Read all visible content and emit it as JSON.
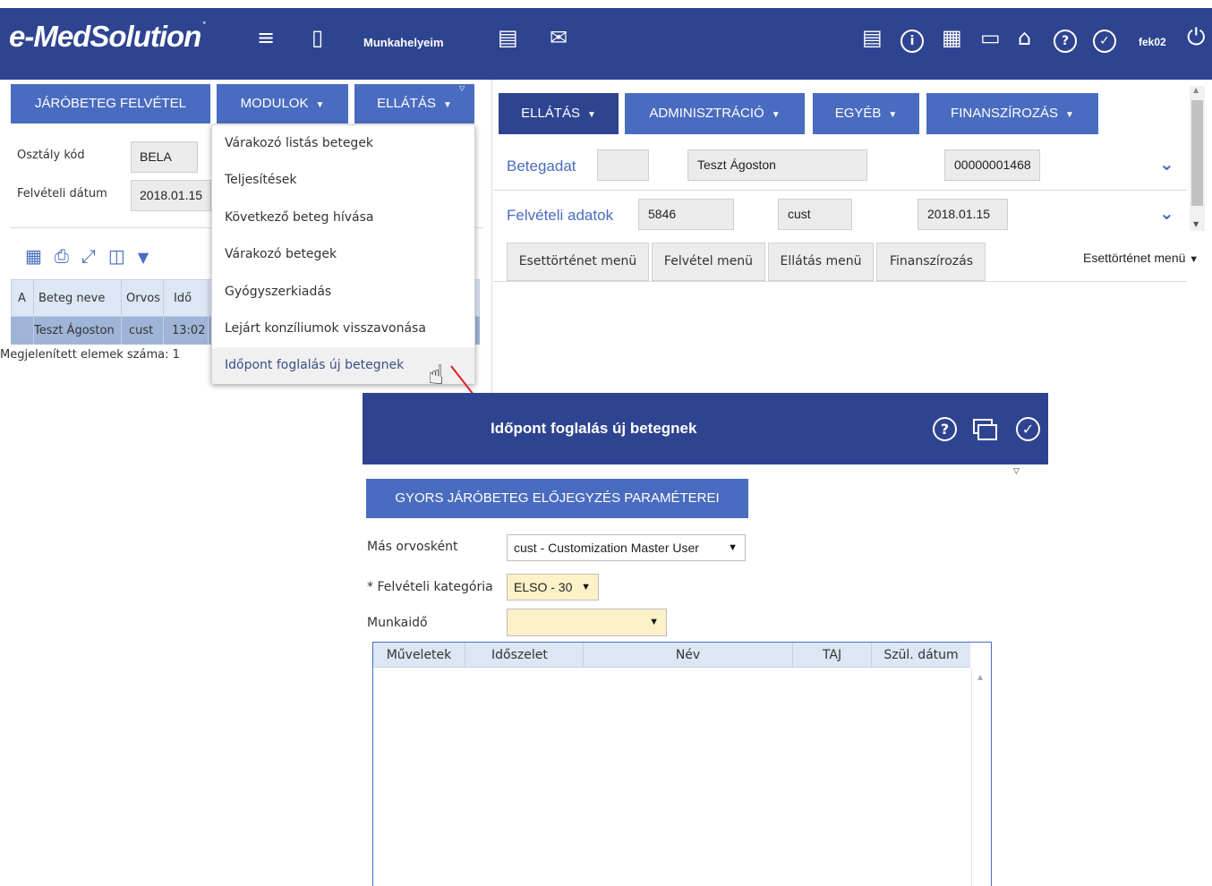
{
  "header": {
    "logo": "e-MedSolution",
    "logo_mark": "°",
    "workplaces_label": "Munkahelyeim",
    "username": "fek02",
    "icons": [
      "person-list-icon",
      "exit-door-icon",
      "clipboard-icon",
      "envelope-icon",
      "document-clock-icon",
      "info-icon",
      "calculator-icon",
      "lock-icon",
      "home-icon",
      "help-icon",
      "check-icon",
      "power-icon"
    ]
  },
  "left": {
    "buttons": {
      "felvetel": "JÁRÓBETEG FELVÉTEL",
      "modulok": "MODULOK",
      "ellatas": "ELLÁTÁS"
    },
    "osztaly_label": "Osztály kód",
    "osztaly_value": "BELA",
    "felveteli_label": "Felvételi dátum",
    "felveteli_value": "2018.01.15",
    "grid": {
      "columns": [
        "A",
        "Beteg neve",
        "Orvos",
        "Idő"
      ],
      "row": {
        "name": "Teszt Ágoston",
        "doctor": "cust",
        "time": "13:02"
      }
    },
    "count_text": "Megjelenített elemek száma: 1"
  },
  "dropdown": {
    "items": [
      "Várakozó listás betegek",
      "Teljesítések",
      "Következő beteg hívása",
      "Várakozó betegek",
      "Gyógyszerkiadás",
      "Lejárt konzíliumok visszavonása",
      "Időpont foglalás új betegnek"
    ]
  },
  "right": {
    "buttons": {
      "ellatas": "ELLÁTÁS",
      "adminisztracio": "ADMINISZTRÁCIÓ",
      "egyeb": "EGYÉB",
      "finanszirozas": "FINANSZÍROZÁS"
    },
    "betegadat_label": "Betegadat",
    "betegadat_name": "Teszt Ágoston",
    "betegadat_id": "00000001468",
    "felveteli_label": "Felvételi adatok",
    "felveteli_num": "5846",
    "felveteli_user": "cust",
    "felveteli_date": "2018.01.15",
    "tabs": [
      "Esettörténet menü",
      "Felvétel menü",
      "Ellátás menü",
      "Finanszírozás"
    ],
    "tab_select": "Esettörténet menü"
  },
  "modal": {
    "title": "Időpont foglalás új betegnek",
    "section_button": "GYORS JÁRÓBETEG ELŐJEGYZÉS PARAMÉTEREI",
    "doctor_label": "Más orvosként",
    "doctor_value": "cust - Customization Master User",
    "category_label": "* Felvételi kategória",
    "category_value": "ELSO - 30",
    "worktime_label": "Munkaidő",
    "worktime_value": "",
    "grid_columns": [
      "Műveletek",
      "Időszelet",
      "Név",
      "TAJ",
      "Szül. dátum"
    ]
  },
  "colors": {
    "primary": "#2f4490",
    "accent": "#4a6cc0",
    "highlight": "#fdf1c8"
  }
}
